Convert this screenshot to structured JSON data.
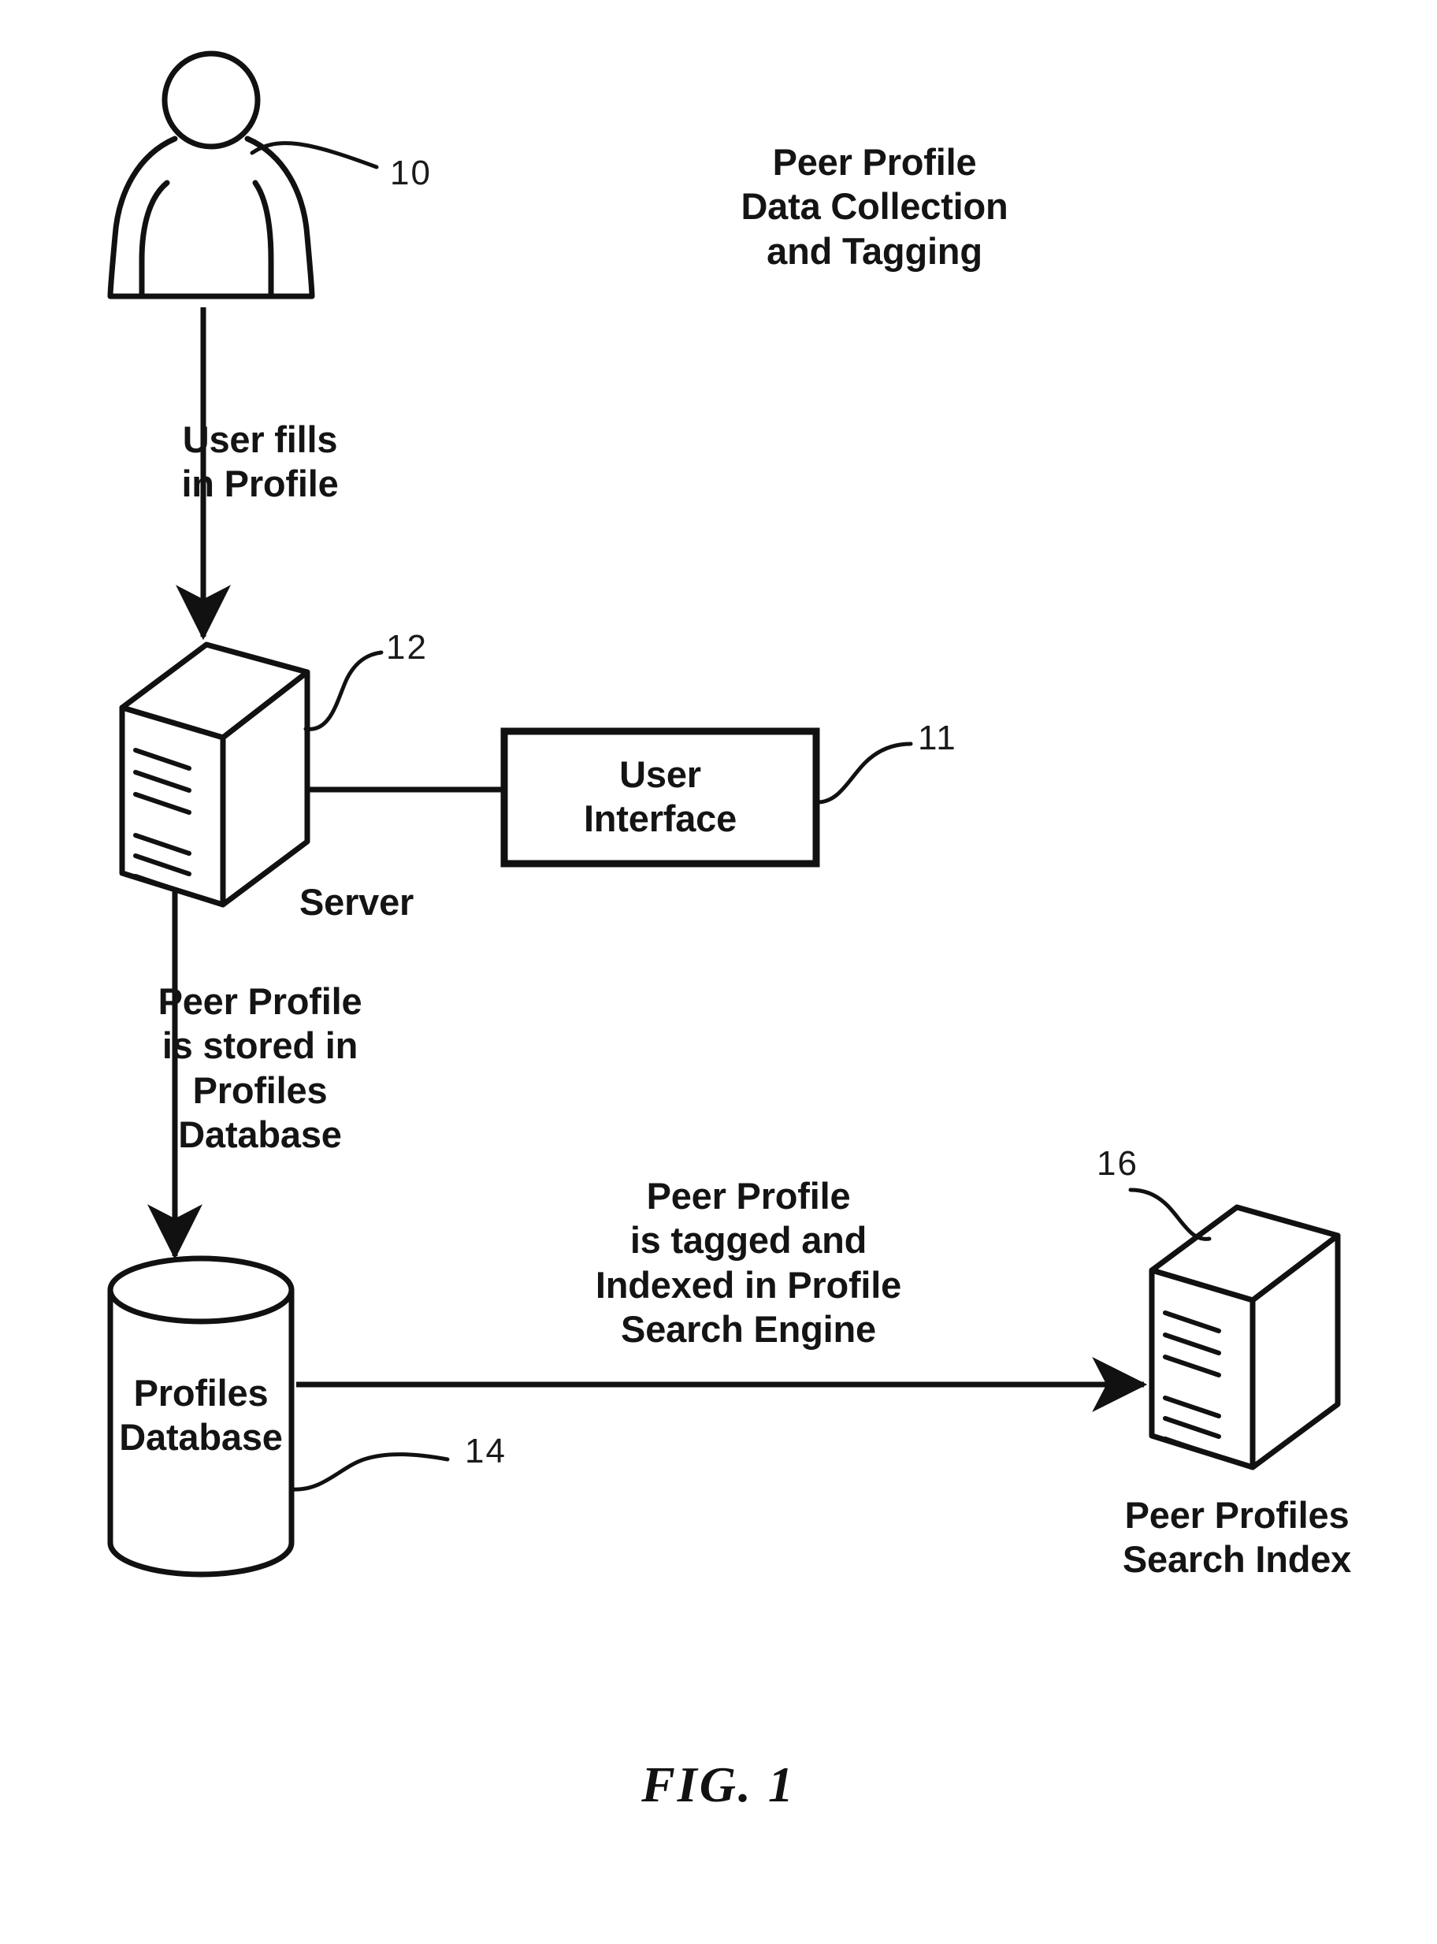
{
  "figure": {
    "caption": "FIG.  1",
    "title_block": "Peer Profile\nData Collection\nand Tagging",
    "background": "#ffffff",
    "ink_color": "#111111"
  },
  "nodes": {
    "user": {
      "icon": "person-icon",
      "reference_numeral": "10"
    },
    "server": {
      "icon": "server-tower-icon",
      "label": "Server",
      "reference_numeral": "12"
    },
    "user_interface": {
      "label": "User\nInterface",
      "reference_numeral": "11"
    },
    "profiles_database": {
      "icon": "database-cylinder-icon",
      "label": "Profiles\nDatabase",
      "reference_numeral": "14"
    },
    "search_index": {
      "icon": "server-tower-icon",
      "label": "Peer Profiles\nSearch Index",
      "reference_numeral": "16"
    }
  },
  "flows": [
    {
      "id": "user-to-server",
      "label": "User fills\nin Profile",
      "from": "user",
      "to": "server",
      "direction": "down"
    },
    {
      "id": "server-to-database",
      "label": "Peer Profile\nis stored in\nProfiles\nDatabase",
      "from": "server",
      "to": "profiles_database",
      "direction": "down"
    },
    {
      "id": "database-to-search-index",
      "label": "Peer Profile\nis tagged and\nIndexed in Profile\nSearch Engine",
      "from": "profiles_database",
      "to": "search_index",
      "direction": "right"
    }
  ],
  "connectors": [
    {
      "id": "server-to-user-interface",
      "from": "server",
      "to": "user_interface",
      "style": "plain-line"
    }
  ]
}
